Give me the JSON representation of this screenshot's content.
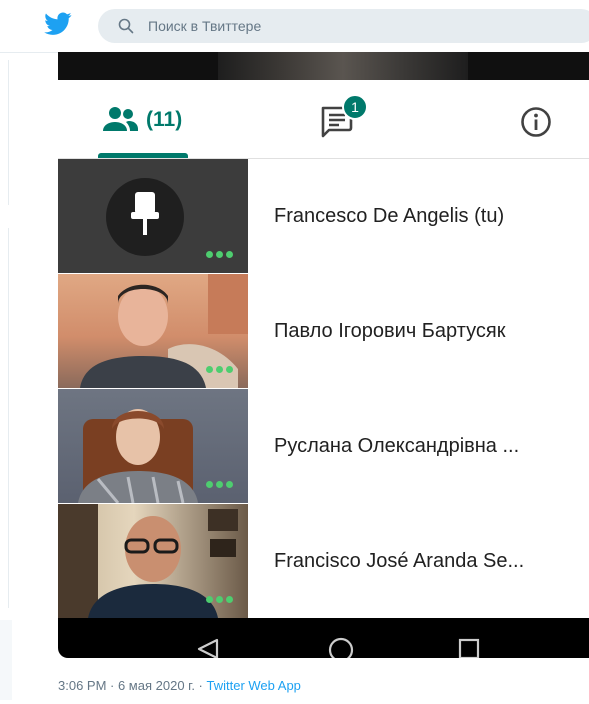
{
  "header": {
    "logo_icon": "twitter-bird-icon",
    "search": {
      "icon": "search-icon",
      "placeholder": "Поиск в Твиттере"
    }
  },
  "meet": {
    "tabs": {
      "people_icon": "people-icon",
      "people_count": "(11)",
      "chat_icon": "chat-icon",
      "chat_badge": "1",
      "info_icon": "info-icon"
    },
    "participants": [
      {
        "name": "Francesco De Angelis (tu)",
        "avatar": "pushpin-avatar"
      },
      {
        "name": "Павло Ігорович Бартусяк",
        "avatar": "video-thumbnail"
      },
      {
        "name": "Руслана Олександрівна ...",
        "avatar": "video-thumbnail"
      },
      {
        "name": "Francisco José Aranda Se...",
        "avatar": "video-thumbnail"
      }
    ],
    "nav": {
      "back_icon": "back-triangle-icon",
      "home_icon": "home-circle-icon",
      "recent_icon": "recent-square-icon"
    }
  },
  "footer": {
    "timestamp": "3:06 PM · 6 мая 2020 г. · ",
    "source": "Twitter Web App"
  },
  "colors": {
    "accent": "#00796b",
    "twitter_blue": "#1da1f2",
    "speaking_dots": "#4ecd6f"
  }
}
